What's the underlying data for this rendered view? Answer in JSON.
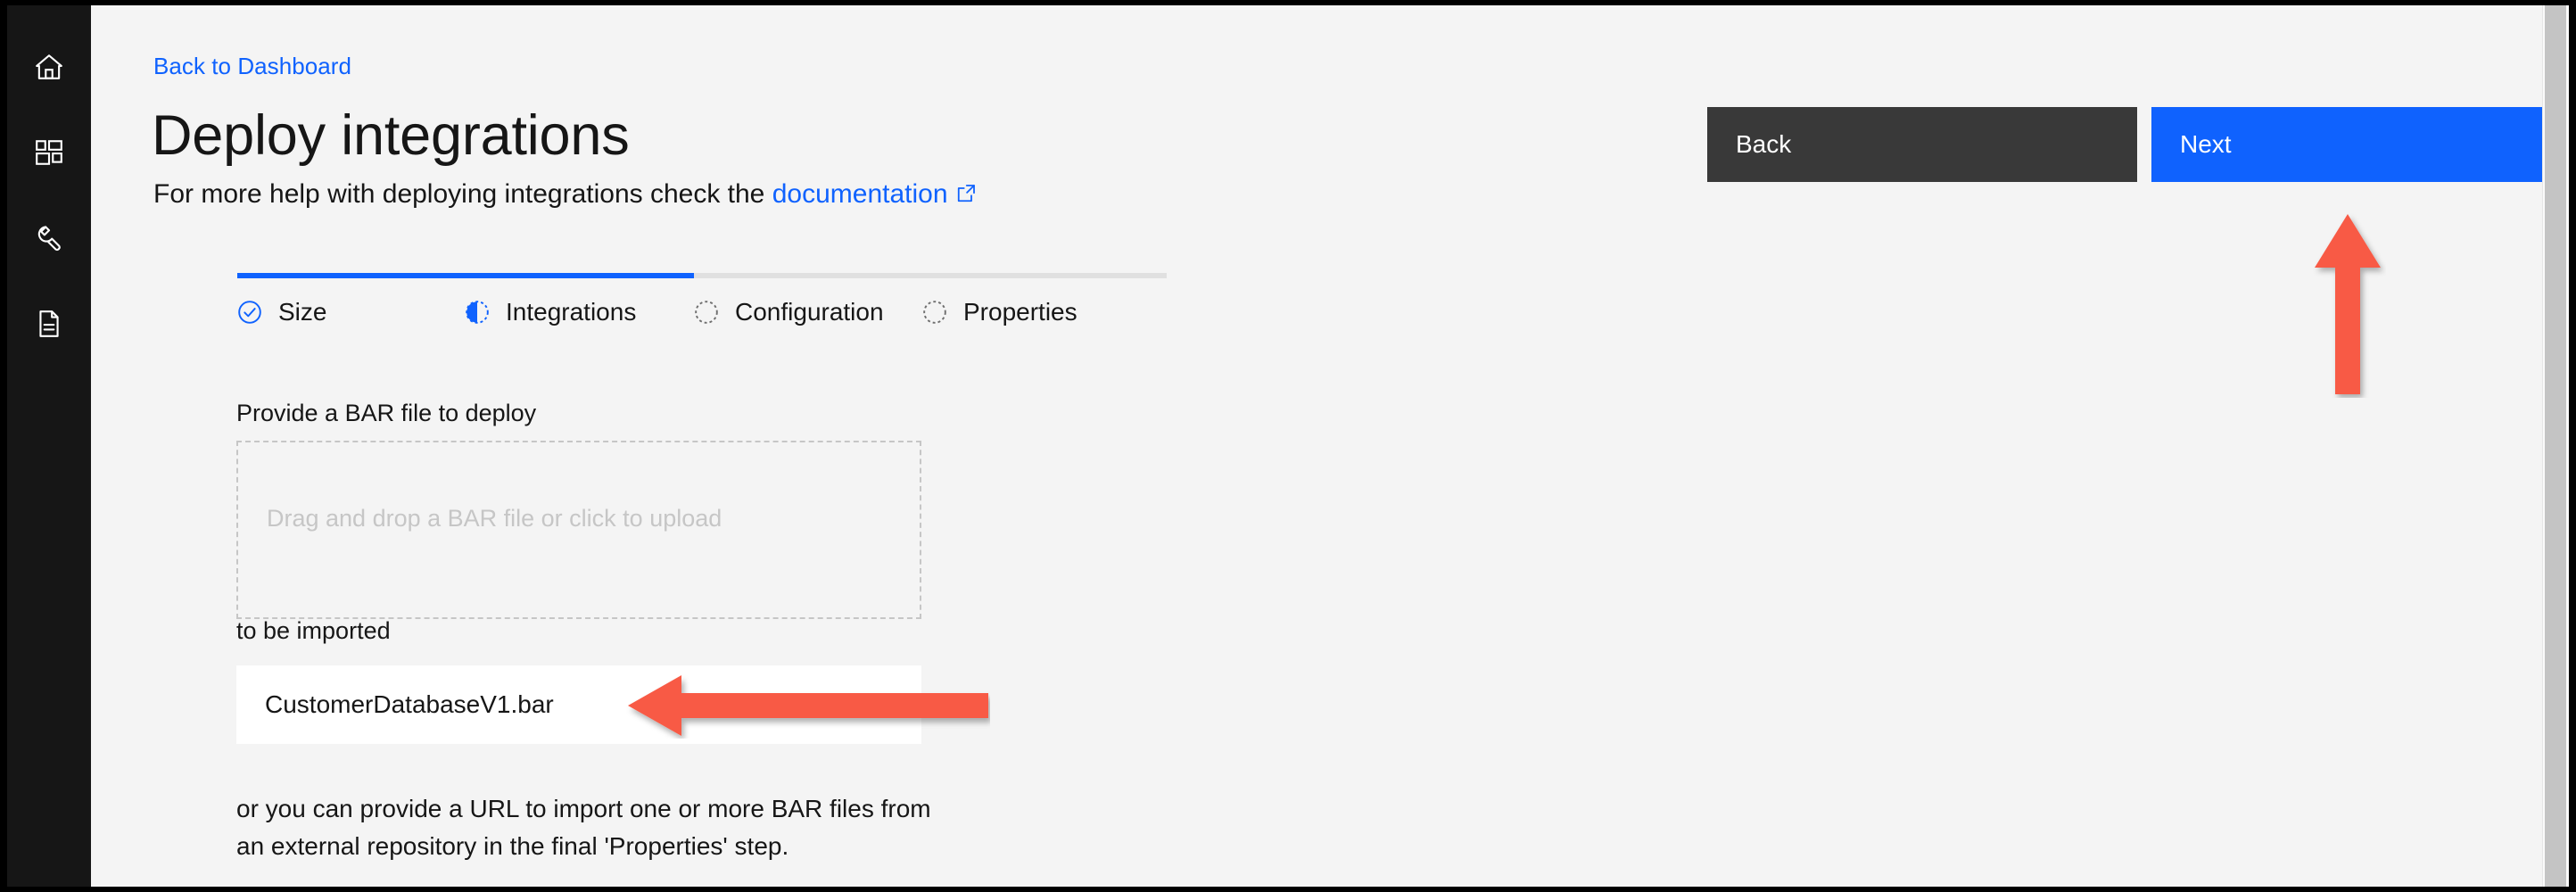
{
  "sidebar": {
    "items": [
      {
        "name": "home",
        "icon": "home-icon"
      },
      {
        "name": "dashboard",
        "icon": "dashboard-grid-icon"
      },
      {
        "name": "tools",
        "icon": "wrench-icon"
      },
      {
        "name": "documents",
        "icon": "document-icon"
      }
    ]
  },
  "header": {
    "back_link": "Back to Dashboard",
    "title": "Deploy integrations",
    "subtitle_prefix": "For more help with deploying integrations check the ",
    "subtitle_link": "documentation",
    "external_link_icon": "external-link-icon"
  },
  "actions": {
    "back_label": "Back",
    "next_label": "Next"
  },
  "wizard": {
    "progress_percent": 49,
    "steps": [
      {
        "label": "Size",
        "state": "complete",
        "icon": "check-circle-icon"
      },
      {
        "label": "Integrations",
        "state": "current",
        "icon": "half-filled-circle-icon"
      },
      {
        "label": "Configuration",
        "state": "incomplete",
        "icon": "dashed-circle-icon"
      },
      {
        "label": "Properties",
        "state": "incomplete",
        "icon": "dashed-circle-icon"
      }
    ]
  },
  "upload": {
    "field_label": "Provide a BAR file to deploy",
    "dropzone_placeholder": "Drag and drop a BAR file or click to upload",
    "imported_label": "to be imported",
    "files": [
      {
        "name": "CustomerDatabaseV1.bar",
        "remove_icon": "close-icon"
      }
    ],
    "helper_text": "or you can provide a URL to import one or more BAR files from an external repository in the final 'Properties' step."
  },
  "annotations": {
    "arrow_color": "#f85a45",
    "arrow_up_target": "next-button",
    "arrow_left_target": "file-chip"
  },
  "colors": {
    "accent_blue": "#0f62fe",
    "rail_background": "#161616",
    "page_background": "#f4f4f4",
    "back_button": "#393939",
    "complete_step": "#0f62fe",
    "incomplete_step": "#8d8d8d"
  }
}
